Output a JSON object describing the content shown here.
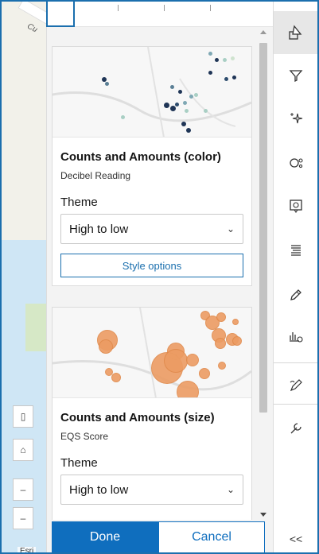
{
  "map": {
    "road_label": "Cu",
    "attribution": "Esri"
  },
  "cards": [
    {
      "title": "Counts and Amounts (color)",
      "subtitle": "Decibel Reading",
      "theme_label": "Theme",
      "theme_value": "High to low",
      "style_button": "Style options"
    },
    {
      "title": "Counts and Amounts (size)",
      "subtitle": "EQS Score",
      "theme_label": "Theme",
      "theme_value": "High to low"
    }
  ],
  "footer": {
    "done_label": "Done",
    "cancel_label": "Cancel"
  },
  "toolbar": {
    "items": [
      {
        "icon": "styles-icon",
        "active": true
      },
      {
        "icon": "filter-icon"
      },
      {
        "icon": "effects-icon"
      },
      {
        "icon": "clustering-icon"
      },
      {
        "icon": "popups-icon"
      },
      {
        "icon": "labels-icon"
      },
      {
        "icon": "edit-icon"
      },
      {
        "icon": "charts-icon"
      },
      {
        "icon": "sketch-icon"
      },
      {
        "icon": "configure-icon"
      }
    ],
    "collapse_label": "<<"
  },
  "colors": {
    "accent": "#0f6ebe",
    "bubble": "#ec9c63",
    "dot_dark": "#1f3556",
    "dot_light": "#a9cfc4"
  }
}
